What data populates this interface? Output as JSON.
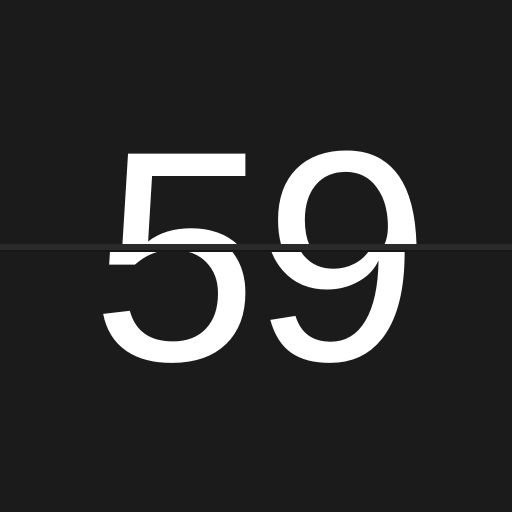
{
  "clock": {
    "value": "59",
    "background_color": "#1b1b1b",
    "digit_color": "#ffffff"
  }
}
